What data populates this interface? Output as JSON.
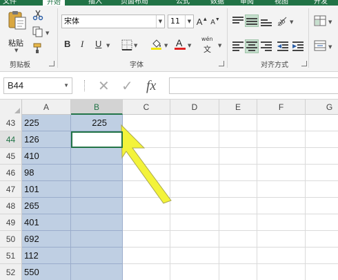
{
  "tabs": [
    {
      "label": "文件",
      "active": false
    },
    {
      "label": "开始",
      "active": true
    },
    {
      "label": "插入",
      "active": false
    },
    {
      "label": "页面布局",
      "active": false
    },
    {
      "label": "公式",
      "active": false
    },
    {
      "label": "数据",
      "active": false
    },
    {
      "label": "审阅",
      "active": false
    },
    {
      "label": "视图",
      "active": false
    },
    {
      "label": "开发",
      "active": false
    }
  ],
  "clipboard": {
    "paste_label": "粘贴",
    "group_label": "剪贴板"
  },
  "font": {
    "name": "宋体",
    "size": "11",
    "group_label": "字体",
    "bold": "B",
    "italic": "I",
    "underline": "U",
    "color_label": "A",
    "grow": "A",
    "shrink": "A",
    "phonetic": "wén"
  },
  "alignment": {
    "group_label": "对齐方式"
  },
  "formula_bar": {
    "name_box": "B44",
    "cancel": "✕",
    "enter": "✓",
    "fx": "fx",
    "value": ""
  },
  "columns": [
    "A",
    "B",
    "C",
    "D",
    "E",
    "F",
    "G"
  ],
  "rows": [
    {
      "num": "43",
      "a": "225",
      "b": "225"
    },
    {
      "num": "44",
      "a": "126",
      "b": ""
    },
    {
      "num": "45",
      "a": "410",
      "b": ""
    },
    {
      "num": "46",
      "a": "98",
      "b": ""
    },
    {
      "num": "47",
      "a": "101",
      "b": ""
    },
    {
      "num": "48",
      "a": "265",
      "b": ""
    },
    {
      "num": "49",
      "a": "401",
      "b": ""
    },
    {
      "num": "50",
      "a": "692",
      "b": ""
    },
    {
      "num": "51",
      "a": "112",
      "b": ""
    },
    {
      "num": "52",
      "a": "550",
      "b": ""
    }
  ],
  "selection": {
    "active_cell": "B44",
    "shaded_columns": [
      "A",
      "B"
    ]
  },
  "colors": {
    "accent": "#217346",
    "selection_fill": "#bfcfe3",
    "annotation_arrow": "#f3f33a"
  }
}
